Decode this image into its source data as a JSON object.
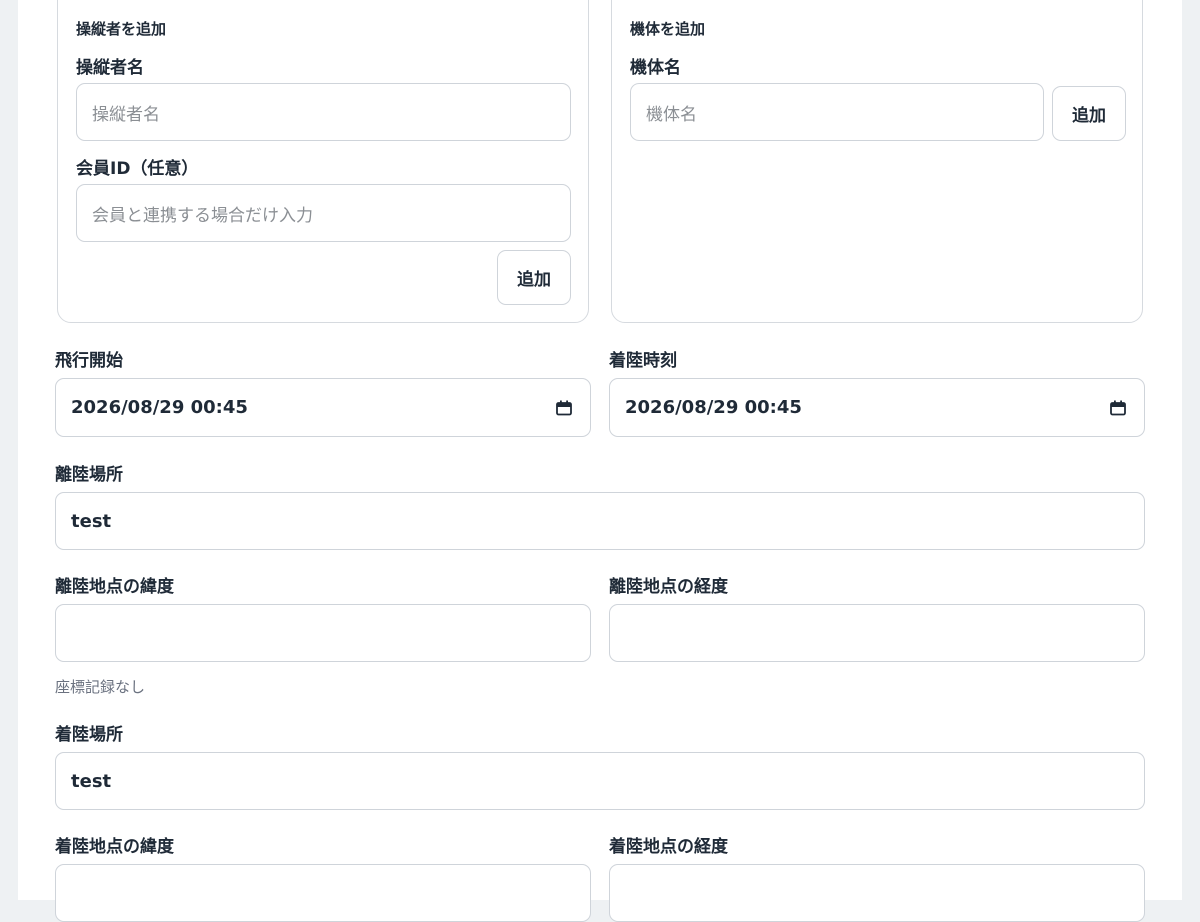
{
  "pilot_card": {
    "title": "操縦者を追加",
    "name_label": "操縦者名",
    "name_placeholder": "操縦者名",
    "member_label": "会員ID（任意）",
    "member_placeholder": "会員と連携する場合だけ入力",
    "add_label": "追加"
  },
  "aircraft_card": {
    "title": "機体を追加",
    "name_label": "機体名",
    "name_placeholder": "機体名",
    "add_label": "追加"
  },
  "flight": {
    "start_label": "飛行開始",
    "start_value": "2026/08/29 00:45",
    "landing_time_label": "着陸時刻",
    "landing_time_value": "2026/08/29 00:45",
    "takeoff_place_label": "離陸場所",
    "takeoff_place_value": "test",
    "takeoff_lat_label": "離陸地点の緯度",
    "takeoff_lat_value": "",
    "takeoff_lng_label": "離陸地点の経度",
    "takeoff_lng_value": "",
    "no_coords_hint": "座標記録なし",
    "landing_place_label": "着陸場所",
    "landing_place_value": "test",
    "landing_lat_label": "着陸地点の緯度",
    "landing_lat_value": "",
    "landing_lng_label": "着陸地点の経度",
    "landing_lng_value": ""
  },
  "icons": {
    "calendar": "calendar-icon"
  }
}
